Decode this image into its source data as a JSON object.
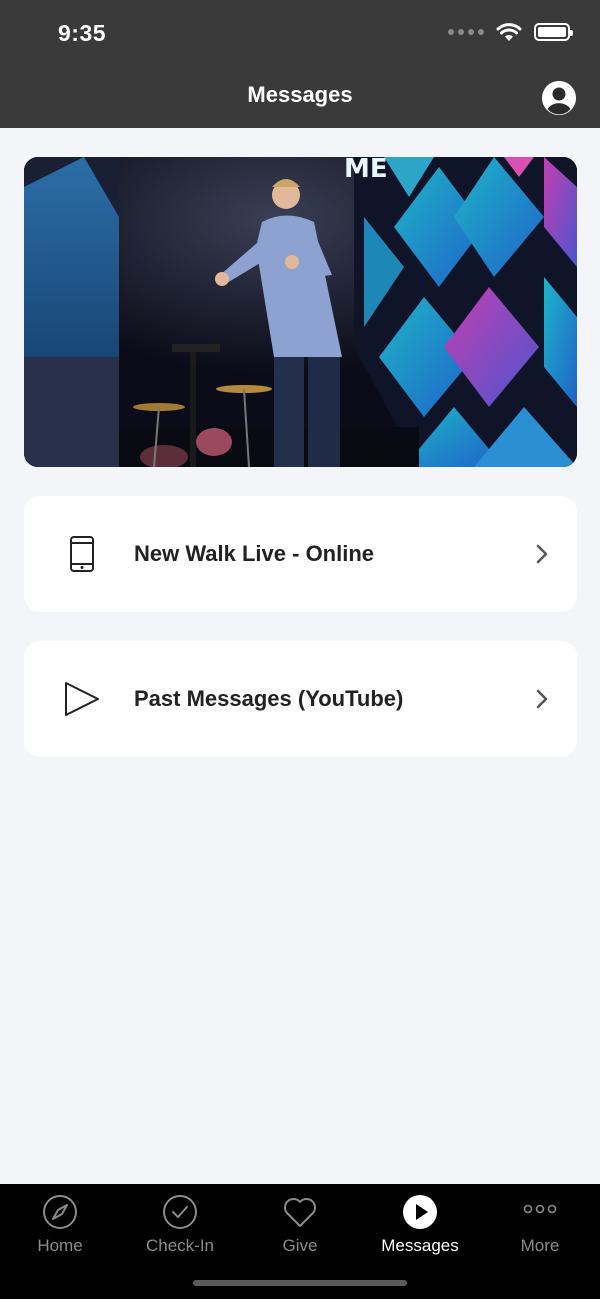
{
  "status_bar": {
    "time": "9:35"
  },
  "header": {
    "title": "Messages",
    "profile_icon": "person-circle-icon"
  },
  "hero": {
    "image_description_icon": "speaker-on-stage-image"
  },
  "cards": [
    {
      "label": "New Walk Live - Online",
      "icon": "smartphone-icon"
    },
    {
      "label": "Past Messages (YouTube)",
      "icon": "play-outline-icon"
    }
  ],
  "tabs": [
    {
      "label": "Home",
      "icon": "compass-icon",
      "active": false
    },
    {
      "label": "Check-In",
      "icon": "check-circle-icon",
      "active": false
    },
    {
      "label": "Give",
      "icon": "heart-icon",
      "active": false
    },
    {
      "label": "Messages",
      "icon": "play-circle-icon",
      "active": true
    },
    {
      "label": "More",
      "icon": "more-dots-icon",
      "active": false
    }
  ],
  "colors": {
    "header_bg": "#3a3a3a",
    "page_bg": "#f4f5f9",
    "tabbar_bg": "#000000",
    "tab_active": "#ffffff",
    "tab_inactive": "#8b8b8b"
  }
}
